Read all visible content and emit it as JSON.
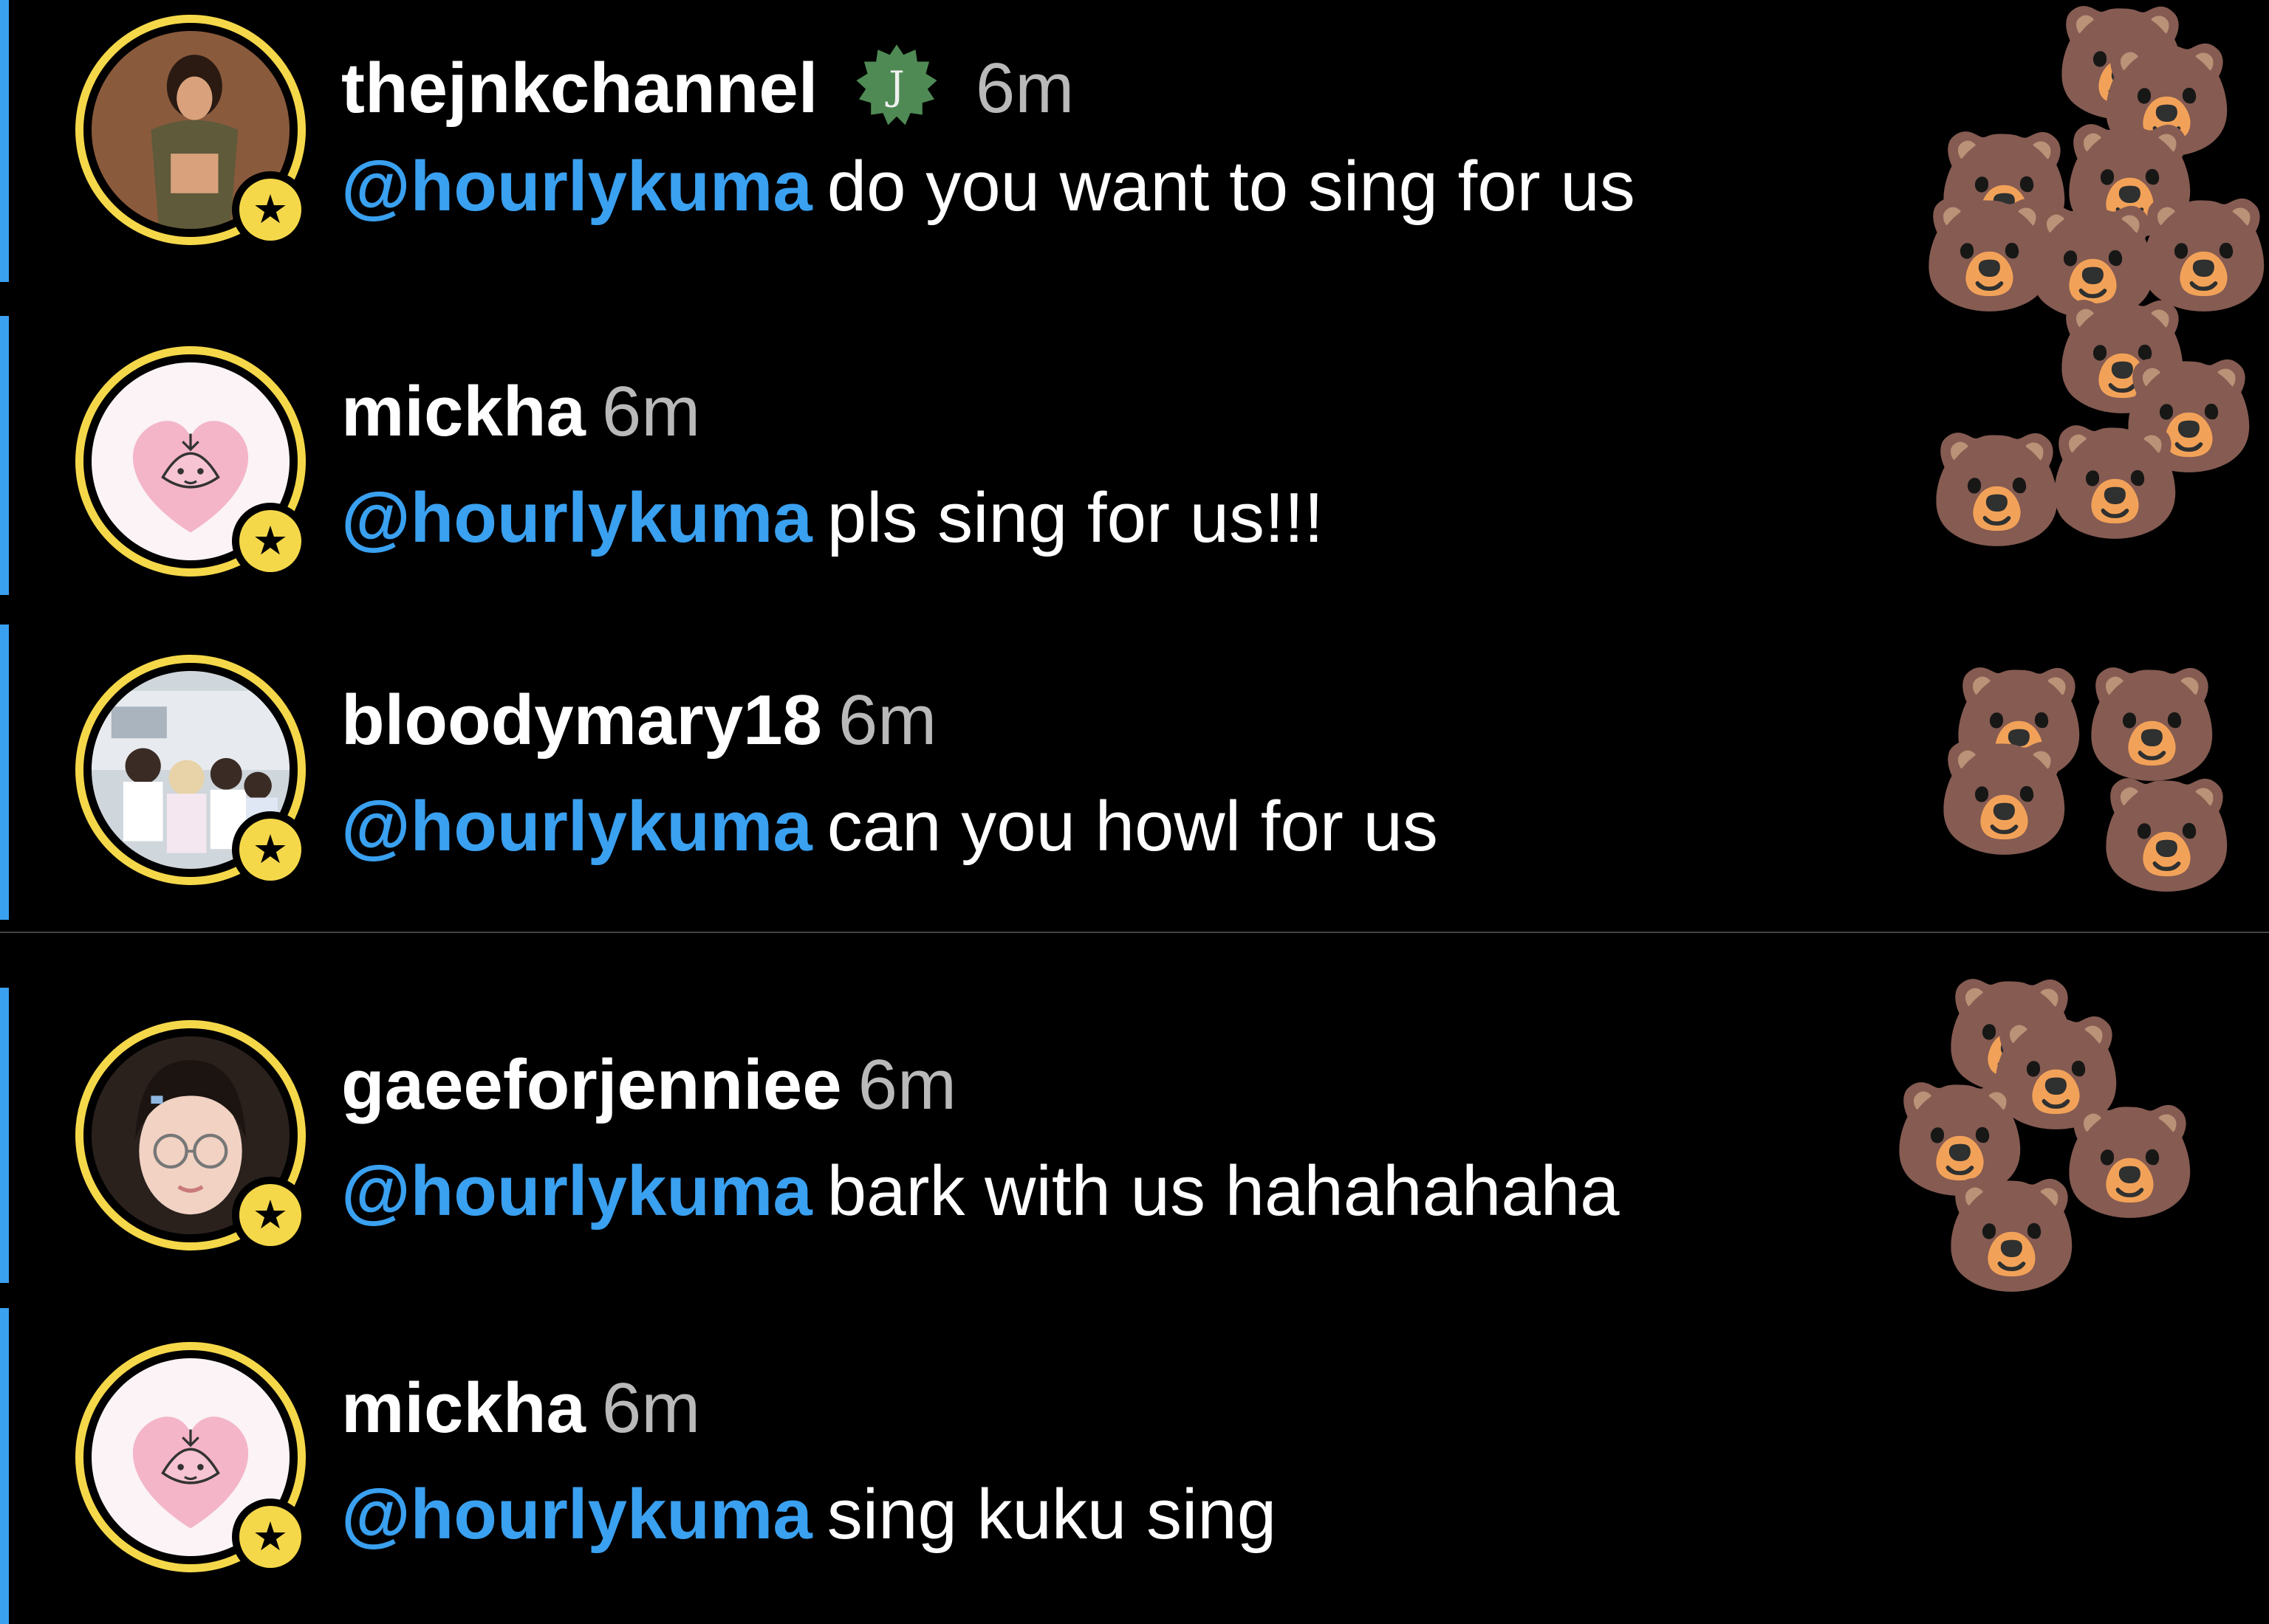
{
  "comments": [
    {
      "username": "thejnkchannel",
      "time": "6m",
      "verified_badge_letter": "J",
      "mention": "@hourlykuma",
      "text": "do you want to sing for us"
    },
    {
      "username": "mickha",
      "time": "6m",
      "mention": "@hourlykuma",
      "text": "pls sing for us!!!"
    },
    {
      "username": "bloodymary18",
      "time": "6m",
      "mention": "@hourlykuma",
      "text": "can you howl for us"
    },
    {
      "username": "gaeeforjenniee",
      "time": "6m",
      "mention": "@hourlykuma",
      "text": "bark with us hahahahaha"
    },
    {
      "username": "mickha",
      "time": "6m",
      "mention": "@hourlykuma",
      "text": "sing kuku sing"
    }
  ],
  "icons": {
    "star_badge": "star-icon",
    "bear_emoji": "🐻",
    "star_glyph": "★"
  },
  "colors": {
    "background": "#000000",
    "mention_blue": "#3aa0f0",
    "ring_yellow": "#f5d84a",
    "time_gray": "#b9b9b9"
  }
}
